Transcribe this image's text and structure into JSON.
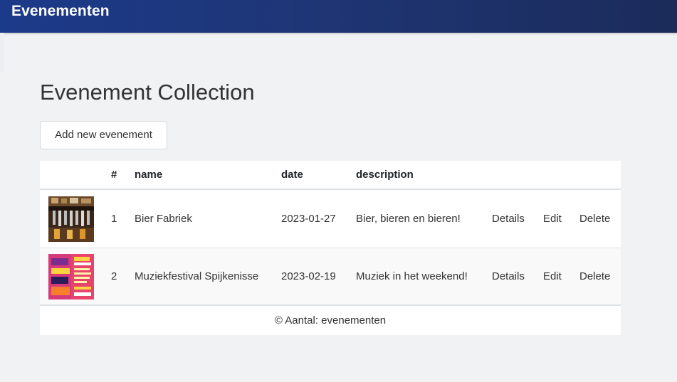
{
  "header": {
    "brand": "Evenementen"
  },
  "main": {
    "title": "Evenement Collection",
    "add_button": "Add new evenement"
  },
  "table": {
    "columns": [
      "#",
      "name",
      "date",
      "description"
    ],
    "rows": [
      {
        "image_icon": "bar-taps-image",
        "number": "1",
        "name": "Bier Fabriek",
        "date": "2023-01-27",
        "description": "Bier, bieren en bieren!",
        "details": "Details",
        "edit": "Edit",
        "delete": "Delete"
      },
      {
        "image_icon": "festival-poster-image",
        "number": "2",
        "name": "Muziekfestival Spijkenisse",
        "date": "2023-02-19",
        "description": "Muziek in het weekend!",
        "details": "Details",
        "edit": "Edit",
        "delete": "Delete"
      }
    ],
    "footer": "© Aantal: evenementen"
  },
  "colors": {
    "header_start": "#1c3a8a",
    "header_end": "#1b2b5a",
    "background": "#f1f2f4",
    "table_bg": "#ffffff"
  }
}
